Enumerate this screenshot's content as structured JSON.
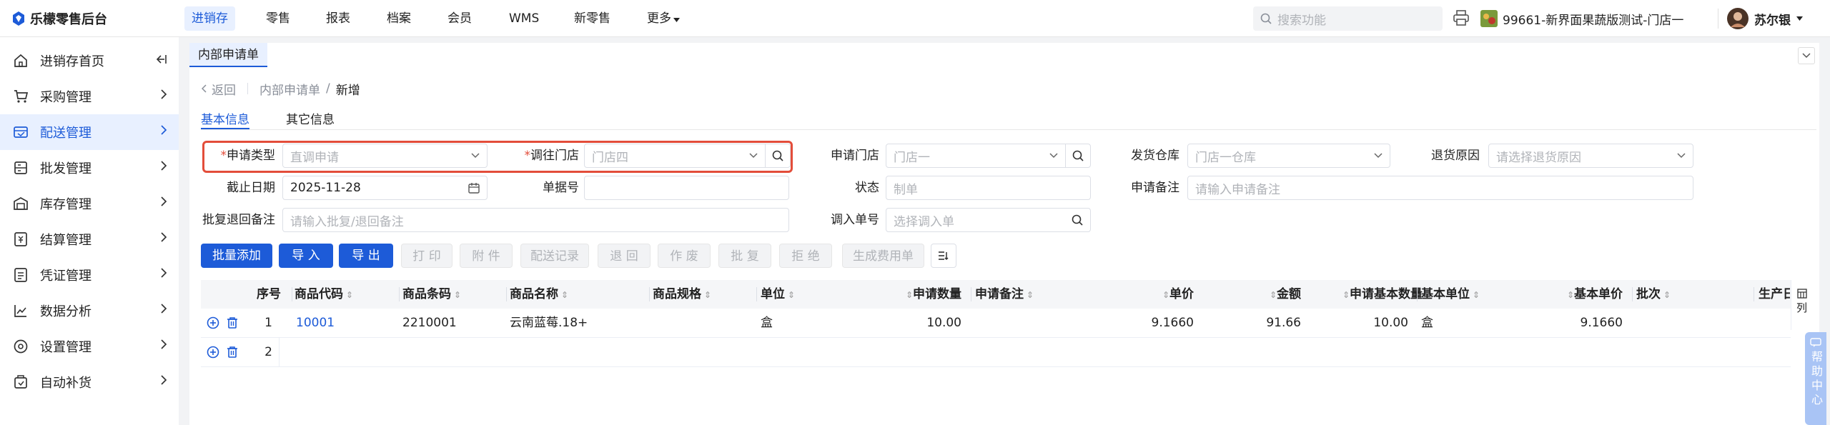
{
  "app": {
    "title": "乐檬零售后台"
  },
  "topnav": {
    "items": [
      {
        "label": "进销存"
      },
      {
        "label": "零售"
      },
      {
        "label": "报表"
      },
      {
        "label": "档案"
      },
      {
        "label": "会员"
      },
      {
        "label": "WMS"
      },
      {
        "label": "新零售"
      },
      {
        "label": "更多"
      }
    ],
    "search_placeholder": "搜索功能",
    "store": "99661-新界面果蔬版测试-门店一",
    "user": "苏尔银"
  },
  "sidebar": {
    "items": [
      {
        "label": "进销存首页",
        "icon": "home-icon"
      },
      {
        "label": "采购管理",
        "icon": "cart-icon"
      },
      {
        "label": "配送管理",
        "icon": "truck-icon"
      },
      {
        "label": "批发管理",
        "icon": "wholesale-icon"
      },
      {
        "label": "库存管理",
        "icon": "inventory-icon"
      },
      {
        "label": "结算管理",
        "icon": "settlement-icon"
      },
      {
        "label": "凭证管理",
        "icon": "voucher-icon"
      },
      {
        "label": "数据分析",
        "icon": "chart-icon"
      },
      {
        "label": "设置管理",
        "icon": "settings-icon"
      },
      {
        "label": "自动补货",
        "icon": "replenish-icon"
      }
    ]
  },
  "page": {
    "tab": "内部申请单",
    "back": "返回",
    "breadcrumb_parent": "内部申请单",
    "breadcrumb_sep": "/",
    "breadcrumb_current": "新增",
    "subtabs": [
      "基本信息",
      "其它信息"
    ]
  },
  "form": {
    "apply_type": {
      "star": "*",
      "label": "申请类型",
      "value": "直调申请"
    },
    "transfer_store": {
      "star": "*",
      "label": "调往门店",
      "value": "门店四"
    },
    "apply_store": {
      "label": "申请门店",
      "value": "门店一"
    },
    "ship_warehouse": {
      "label": "发货仓库",
      "value": "门店一仓库"
    },
    "return_reason": {
      "label": "退货原因",
      "placeholder": "请选择退货原因"
    },
    "deadline": {
      "label": "截止日期",
      "value": "2025-11-28"
    },
    "doc_no": {
      "label": "单据号",
      "value": ""
    },
    "status": {
      "label": "状态",
      "value": "制单"
    },
    "apply_remark": {
      "label": "申请备注",
      "placeholder": "请输入申请备注"
    },
    "reply_remark": {
      "label": "批复退回备注",
      "placeholder": "请输入批复/退回备注"
    },
    "in_doc_no": {
      "label": "调入单号",
      "placeholder": "选择调入单"
    }
  },
  "actions": {
    "batch_add": "批量添加",
    "import": "导 入",
    "export": "导 出",
    "print": "打 印",
    "attach": "附 件",
    "delivery_log": "配送记录",
    "back": "退 回",
    "void": "作 废",
    "approve": "批 复",
    "reject": "拒 绝",
    "gen_fee": "生成费用单"
  },
  "table": {
    "headers": [
      "序号",
      "商品代码",
      "商品条码",
      "商品名称",
      "商品规格",
      "单位",
      "申请数量",
      "申请备注",
      "单价",
      "金额",
      "申请基本数量",
      "基本单位",
      "基本单价",
      "批次",
      "生产日"
    ],
    "rows": [
      {
        "seq": "1",
        "code": "10001",
        "barcode": "2210001",
        "name": "云南蓝莓.18+",
        "spec": "",
        "unit": "盒",
        "qty": "10.00",
        "remark": "",
        "price": "9.1660",
        "amount": "91.66",
        "base_qty": "10.00",
        "base_unit": "盒",
        "base_price": "9.1660",
        "batch": ""
      },
      {
        "seq": "2"
      }
    ],
    "column_setting": "列"
  },
  "help": {
    "label": "帮助中心"
  },
  "colors": {
    "primary": "#1d5bd8",
    "highlight": "#e34d3a",
    "active_bg": "#e8f0ff"
  }
}
